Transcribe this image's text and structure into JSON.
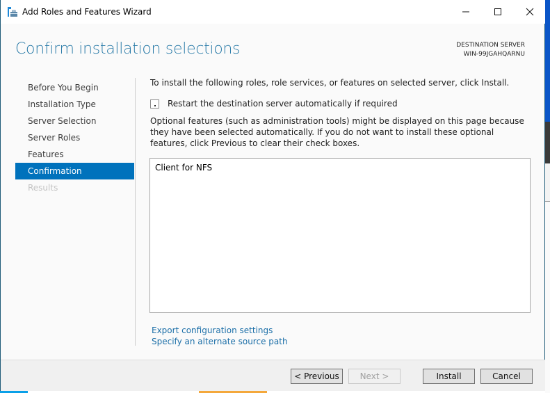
{
  "window": {
    "title": "Add Roles and Features Wizard",
    "app_icon": "server-manager-icon",
    "controls": {
      "minimize": "—",
      "maximize": "☐",
      "close": "✕"
    }
  },
  "header": {
    "page_title": "Confirm installation selections",
    "destination_label": "DESTINATION SERVER",
    "destination_server": "WIN-99JGAHQARNU"
  },
  "nav": {
    "items": [
      {
        "label": "Before You Begin",
        "state": "normal"
      },
      {
        "label": "Installation Type",
        "state": "normal"
      },
      {
        "label": "Server Selection",
        "state": "normal"
      },
      {
        "label": "Server Roles",
        "state": "normal"
      },
      {
        "label": "Features",
        "state": "normal"
      },
      {
        "label": "Confirmation",
        "state": "active"
      },
      {
        "label": "Results",
        "state": "disabled"
      }
    ]
  },
  "content": {
    "intro": "To install the following roles, role services, or features on selected server, click Install.",
    "restart_checkbox": {
      "label": "Restart the destination server automatically if required",
      "checked": false
    },
    "optional_note": "Optional features (such as administration tools) might be displayed on this page because they have been selected automatically. If you do not want to install these optional features, click Previous to clear their check boxes.",
    "selections": [
      "Client for NFS"
    ],
    "links": {
      "export": "Export configuration settings",
      "alternate_source": "Specify an alternate source path"
    }
  },
  "footer": {
    "previous": "< Previous",
    "next": "Next >",
    "install": "Install",
    "cancel": "Cancel"
  },
  "colors": {
    "accent": "#0072bc",
    "title": "#2a7ba8",
    "link": "#1c6fa8"
  }
}
